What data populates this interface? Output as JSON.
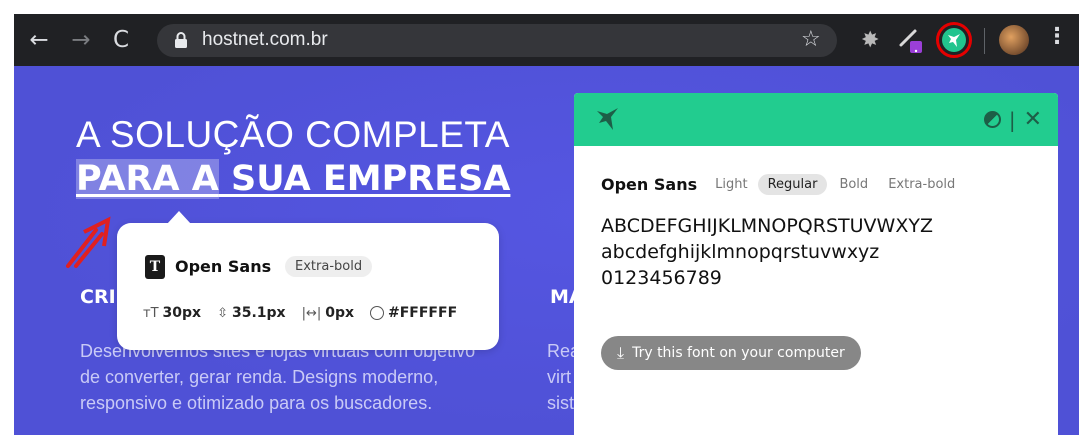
{
  "browser": {
    "url": "hostnet.com.br",
    "back_glyph": "←",
    "forward_glyph": "→",
    "reload_glyph": "C",
    "star_glyph": "☆",
    "gear_glyph": "✸",
    "menu_glyph": "⋮"
  },
  "hero": {
    "line1": "A SOLUÇÃO COMPLETA",
    "line2_highlight": "PARA A",
    "line2_rest": " SUA EMPRESA"
  },
  "columns": [
    {
      "heading": "CRI",
      "text_lines": [
        "Desenvolvemos sites e lojas virtuais com objetivo",
        "de converter, gerar renda. Designs moderno,",
        "responsivo e otimizado para os buscadores."
      ]
    },
    {
      "heading": "MA",
      "text_lines": [
        "Rea",
        "virt",
        "sist"
      ]
    }
  ],
  "tooltip": {
    "font_icon": "T",
    "font_name": "Open Sans",
    "weight": "Extra-bold",
    "size_icon": "ᴛT",
    "size": "30px",
    "line_height_icon": "⇳",
    "line_height": "35.1px",
    "letter_spacing_icon": "|↔|",
    "letter_spacing": "0px",
    "color": "#FFFFFF"
  },
  "panel": {
    "font_name": "Open Sans",
    "weights": [
      "Light",
      "Regular",
      "Bold",
      "Extra-bold"
    ],
    "active_weight": "Regular",
    "separator": "|",
    "close_glyph": "✕",
    "preview_upper": "ABCDEFGHIJKLMNOPQRSTUVWXYZ",
    "preview_lower": "abcdefghijklmnopqrstuvwxyz",
    "preview_digits": "0123456789",
    "download_glyph": "⤓",
    "try_button": "Try this font on your computer"
  },
  "colors": {
    "page_bg": "#4f51d6",
    "panel_header": "#22cc8f",
    "highlight_ring": "#e50000",
    "arrow": "#e02020"
  }
}
